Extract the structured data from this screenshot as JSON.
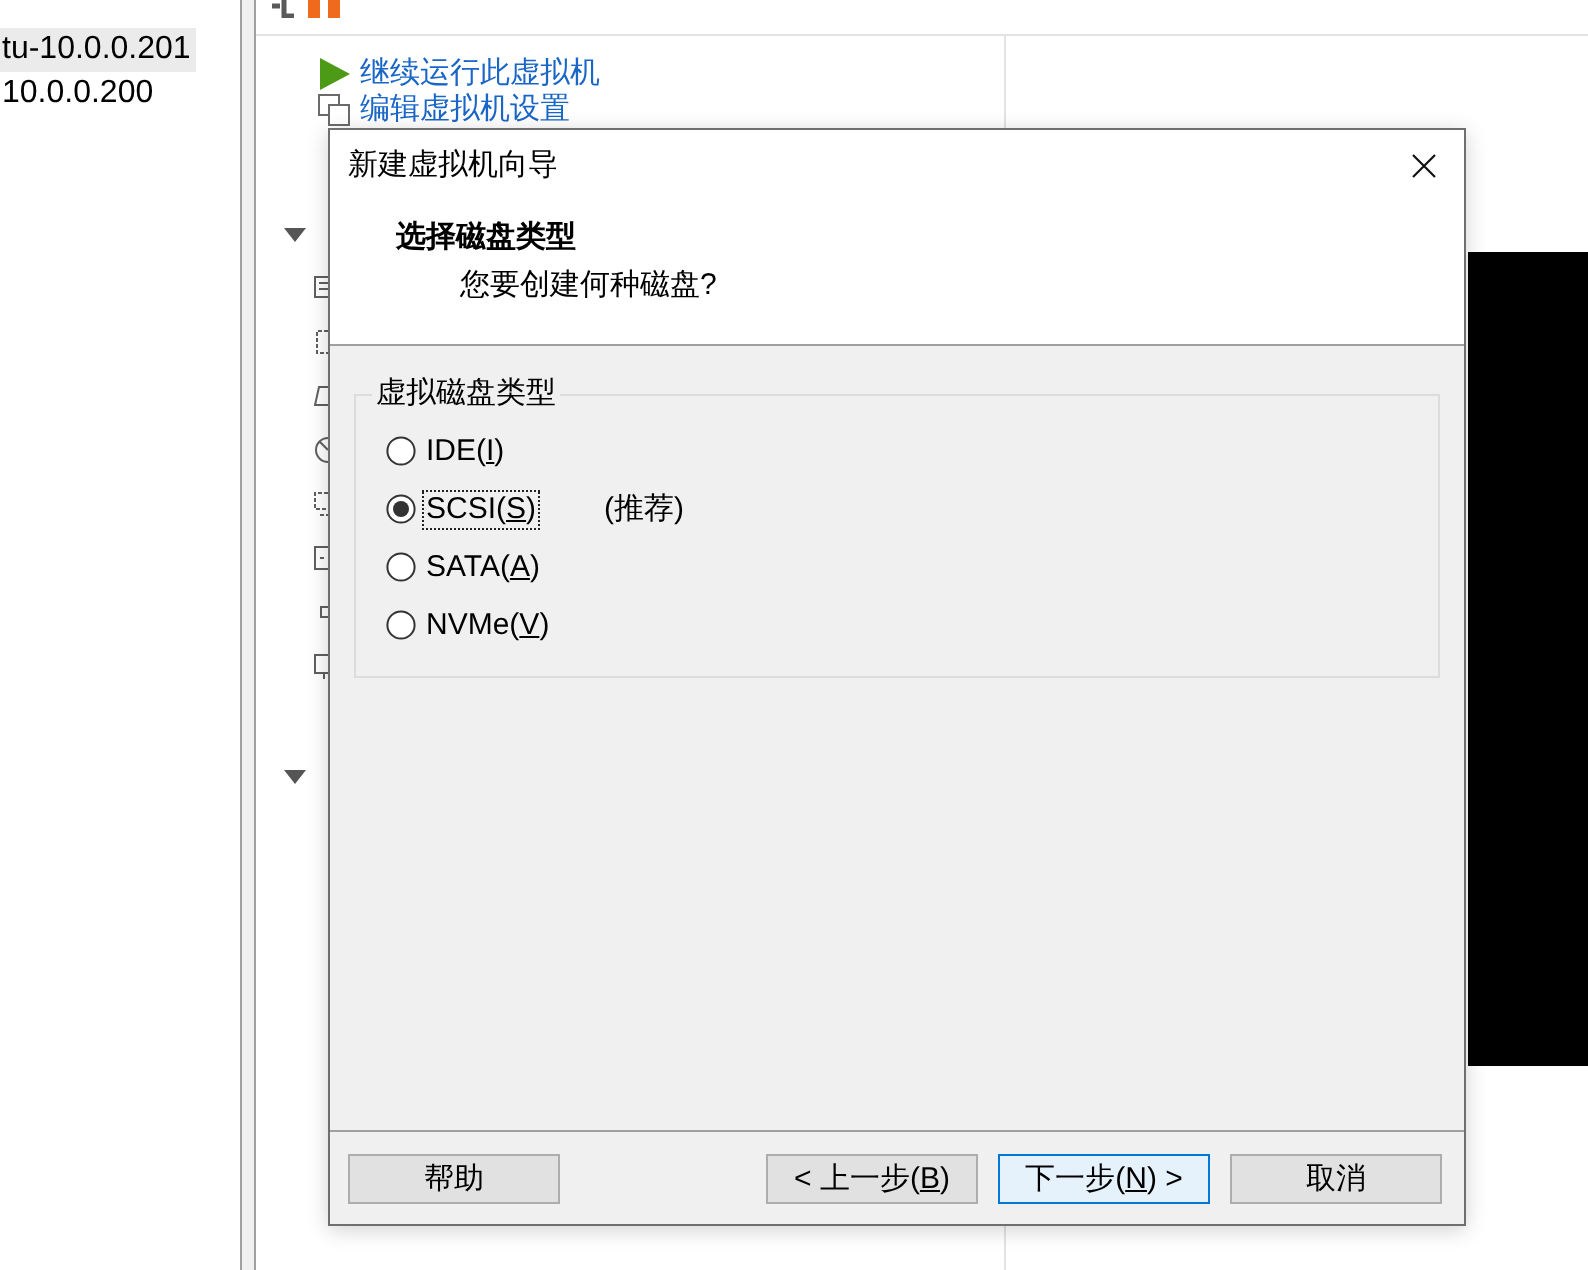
{
  "sidebar": {
    "items": [
      {
        "label": "tu-10.0.0.201",
        "selected": true
      },
      {
        "label": "10.0.0.200",
        "selected": false
      }
    ]
  },
  "vm_panel": {
    "actions": [
      {
        "kind": "play",
        "label": "继续运行此虚拟机"
      },
      {
        "kind": "edit",
        "label": "编辑虚拟机设置"
      }
    ],
    "sections": [
      {
        "expanded": true
      },
      {
        "expanded": true
      }
    ]
  },
  "dialog": {
    "title": "新建虚拟机向导",
    "heading": "选择磁盘类型",
    "subheading": "您要创建何种磁盘?",
    "group": {
      "label": "虚拟磁盘类型",
      "options": [
        {
          "label": "IDE(I)",
          "selected": false,
          "focused": false
        },
        {
          "label": "SCSI(S)",
          "selected": true,
          "focused": true,
          "note": "(推荐)"
        },
        {
          "label": "SATA(A)",
          "selected": false,
          "focused": false
        },
        {
          "label": "NVMe(V)",
          "selected": false,
          "focused": false
        }
      ]
    },
    "buttons": [
      {
        "kind": "help",
        "label": "帮助",
        "default": false
      },
      {
        "kind": "back",
        "label": "< 上一步(B)",
        "default": false
      },
      {
        "kind": "next",
        "label": "下一步(N) >",
        "default": true
      },
      {
        "kind": "cancel",
        "label": "取消",
        "default": false
      }
    ]
  }
}
